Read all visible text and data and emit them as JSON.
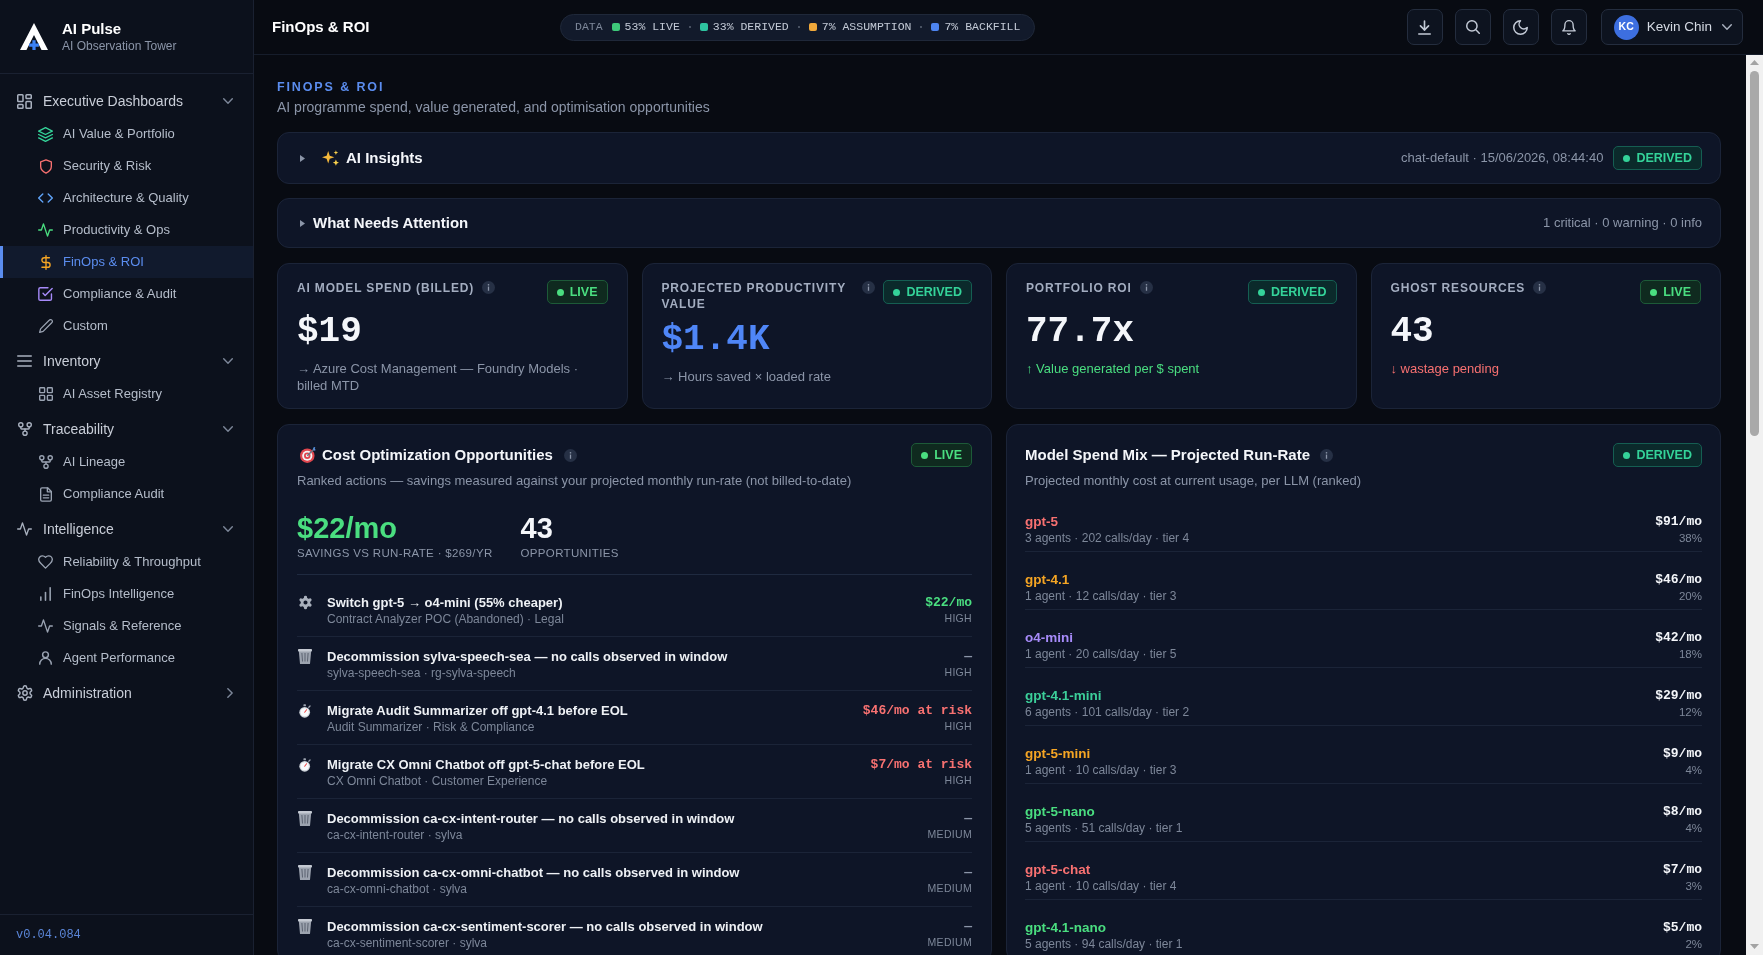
{
  "sidebar": {
    "brand": {
      "name": "AI Pulse",
      "tagline": "AI Observation Tower"
    },
    "groups": [
      {
        "label": "Executive Dashboards",
        "expanded": true,
        "children": [
          {
            "label": "AI Value & Portfolio",
            "selected": false
          },
          {
            "label": "Security & Risk",
            "selected": false
          },
          {
            "label": "Architecture & Quality",
            "selected": false
          },
          {
            "label": "Productivity & Ops",
            "selected": false
          },
          {
            "label": "FinOps & ROI",
            "selected": true
          },
          {
            "label": "Compliance & Audit",
            "selected": false
          },
          {
            "label": "Custom",
            "selected": false
          }
        ]
      },
      {
        "label": "Inventory",
        "expanded": true,
        "children": [
          {
            "label": "AI Asset Registry",
            "selected": false
          }
        ]
      },
      {
        "label": "Traceability",
        "expanded": true,
        "children": [
          {
            "label": "AI Lineage",
            "selected": false
          },
          {
            "label": "Compliance Audit",
            "selected": false
          }
        ]
      },
      {
        "label": "Intelligence",
        "expanded": true,
        "children": [
          {
            "label": "Reliability & Throughput",
            "selected": false
          },
          {
            "label": "FinOps Intelligence",
            "selected": false
          },
          {
            "label": "Signals & Reference",
            "selected": false
          },
          {
            "label": "Agent Performance",
            "selected": false
          }
        ]
      },
      {
        "label": "Administration",
        "expanded": false
      }
    ],
    "version": "v0.04.084"
  },
  "top_bar": {
    "title": "FinOps & ROI",
    "data_mix": {
      "label": "DATA",
      "segments": [
        {
          "label": "53% LIVE",
          "color": "#3ec97a"
        },
        {
          "label": "33% DERIVED",
          "color": "#2ec4a0"
        },
        {
          "label": "7% ASSUMPTION",
          "color": "#f0a83a"
        },
        {
          "label": "7% BACKFILL",
          "color": "#4d84f0"
        }
      ]
    },
    "user": {
      "initials": "KC",
      "name": "Kevin Chin"
    }
  },
  "header": {
    "eyebrow": "FINOPS & ROI",
    "subtitle": "AI programme spend, value generated, and optimisation opportunities"
  },
  "panels": [
    {
      "kind": "insights",
      "title": "AI Insights",
      "expanded": false,
      "meta": "chat-default · 15/06/2026, 08:44:40",
      "badge": {
        "label": "DERIVED",
        "kind": "derived"
      }
    },
    {
      "kind": "attention",
      "title": "What Needs Attention",
      "expanded": false,
      "meta": "1 critical · 0 warning · 0 info"
    }
  ],
  "kpis": [
    {
      "kind": "neutral",
      "label": "AI MODEL SPEND (BILLED)",
      "badge": {
        "label": "LIVE",
        "kind": "live"
      },
      "value": "$19",
      "accent": false,
      "note": "→ Azure Cost Management — Foundry Models · billed MTD"
    },
    {
      "kind": "neutral",
      "label": "PROJECTED PRODUCTIVITY VALUE",
      "badge": {
        "label": "DERIVED",
        "kind": "derived"
      },
      "value": "$1.4K",
      "accent": true,
      "note": "→ Hours saved × loaded rate"
    },
    {
      "kind": "up",
      "label": "PORTFOLIO ROI",
      "badge": {
        "label": "DERIVED",
        "kind": "derived"
      },
      "value": "77.7x",
      "accent": false,
      "note": "↑ Value generated per $ spent"
    },
    {
      "kind": "down",
      "label": "GHOST RESOURCES",
      "badge": {
        "label": "LIVE",
        "kind": "live"
      },
      "value": "43",
      "accent": false,
      "note": "↓ wastage pending"
    }
  ],
  "cost_optimization": {
    "title": "Cost Optimization Opportunities",
    "badge": {
      "label": "LIVE",
      "kind": "live"
    },
    "subtitle": "Ranked actions — savings measured against your projected monthly run-rate (not billed-to-date)",
    "savings": {
      "value": "$22/mo",
      "label": "SAVINGS VS RUN-RATE · $269/YR"
    },
    "count": {
      "value": "43",
      "label": "OPPORTUNITIES"
    },
    "items": [
      {
        "kind": "switch",
        "title": "Switch gpt-5 → o4-mini (55% cheaper)",
        "detail": "Contract Analyzer POC (Abandoned) · Legal",
        "amount": "$22/mo",
        "priority": "HIGH"
      },
      {
        "kind": "decommission",
        "title": "Decommission sylva-speech-sea — no calls observed in window",
        "detail": "sylva-speech-sea · rg-sylva-speech",
        "amount": "—",
        "priority": "HIGH"
      },
      {
        "kind": "migrate",
        "title": "Migrate Audit Summarizer off gpt-4.1 before EOL",
        "detail": "Audit Summarizer · Risk & Compliance",
        "amount": "$46/mo at risk",
        "priority": "HIGH"
      },
      {
        "kind": "migrate",
        "title": "Migrate CX Omni Chatbot off gpt-5-chat before EOL",
        "detail": "CX Omni Chatbot · Customer Experience",
        "amount": "$7/mo at risk",
        "priority": "HIGH"
      },
      {
        "kind": "decommission",
        "title": "Decommission ca-cx-intent-router — no calls observed in window",
        "detail": "ca-cx-intent-router · sylva",
        "amount": "—",
        "priority": "MEDIUM"
      },
      {
        "kind": "decommission",
        "title": "Decommission ca-cx-omni-chatbot — no calls observed in window",
        "detail": "ca-cx-omni-chatbot · sylva",
        "amount": "—",
        "priority": "MEDIUM"
      },
      {
        "kind": "decommission",
        "title": "Decommission ca-cx-sentiment-scorer — no calls observed in window",
        "detail": "ca-cx-sentiment-scorer · sylva",
        "amount": "—",
        "priority": "MEDIUM"
      }
    ]
  },
  "model_spend_mix": {
    "title": "Model Spend Mix — Projected Run-Rate",
    "badge": {
      "label": "DERIVED",
      "kind": "derived"
    },
    "subtitle": "Projected monthly cost at current usage, per LLM (ranked)",
    "rows": [
      {
        "model": "gpt-5",
        "color": "#f87171",
        "usage": "3 agents · 202 calls/day · tier 4",
        "cost": "$91/mo",
        "share": "38%"
      },
      {
        "model": "gpt-4.1",
        "color": "#f5a524",
        "usage": "1 agent · 12 calls/day · tier 3",
        "cost": "$46/mo",
        "share": "20%"
      },
      {
        "model": "o4-mini",
        "color": "#a78bfa",
        "usage": "1 agent · 20 calls/day · tier 5",
        "cost": "$42/mo",
        "share": "18%"
      },
      {
        "model": "gpt-4.1-mini",
        "color": "#3ccf9a",
        "usage": "6 agents · 101 calls/day · tier 2",
        "cost": "$29/mo",
        "share": "12%"
      },
      {
        "model": "gpt-5-mini",
        "color": "#f5a524",
        "usage": "1 agent · 10 calls/day · tier 3",
        "cost": "$9/mo",
        "share": "4%"
      },
      {
        "model": "gpt-5-nano",
        "color": "#4ade80",
        "usage": "5 agents · 51 calls/day · tier 1",
        "cost": "$8/mo",
        "share": "4%"
      },
      {
        "model": "gpt-5-chat",
        "color": "#f87171",
        "usage": "1 agent · 10 calls/day · tier 4",
        "cost": "$7/mo",
        "share": "3%"
      },
      {
        "model": "gpt-4.1-nano",
        "color": "#4ade80",
        "usage": "5 agents · 94 calls/day · tier 1",
        "cost": "$5/mo",
        "share": "2%"
      }
    ]
  }
}
